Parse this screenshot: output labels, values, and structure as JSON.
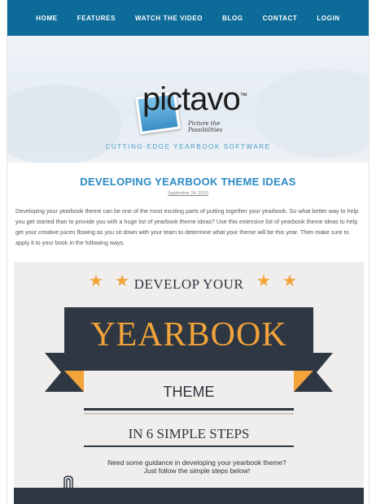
{
  "nav": {
    "items": [
      "HOME",
      "FEATURES",
      "WATCH THE VIDEO",
      "BLOG",
      "CONTACT",
      "LOGIN"
    ]
  },
  "header": {
    "logo_text": "pictavo",
    "logo_tagline": "Picture the Possibilities",
    "tagline": "CUTTING-EDGE YEARBOOK SOFTWARE"
  },
  "post": {
    "title": "DEVELOPING YEARBOOK THEME IDEAS",
    "date": "September 24, 2015",
    "body": "Developing your yearbook theme can be one of the most exciting parts of putting together your yearbook. So what better way to help you get started than to provide you with a huge list of yearbook theme ideas? Use this extensive list of yearbook theme ideas to help get your creative juices flowing as you sit down with your team to determine what your theme will be this year. Then make sure to apply it to your book in the following ways."
  },
  "infographic": {
    "line1": "DEVELOP YOUR",
    "line2": "YEARBOOK",
    "line3": "THEME",
    "line4": "IN 6 SIMPLE STEPS",
    "note_line1": "Need some guidance in developing your yearbook theme?",
    "note_line2": "Just follow the simple steps below!"
  },
  "colors": {
    "nav_bg": "#0d6b99",
    "accent": "#2b8ac4",
    "orange": "#f2a33a",
    "dark": "#2f3743"
  }
}
